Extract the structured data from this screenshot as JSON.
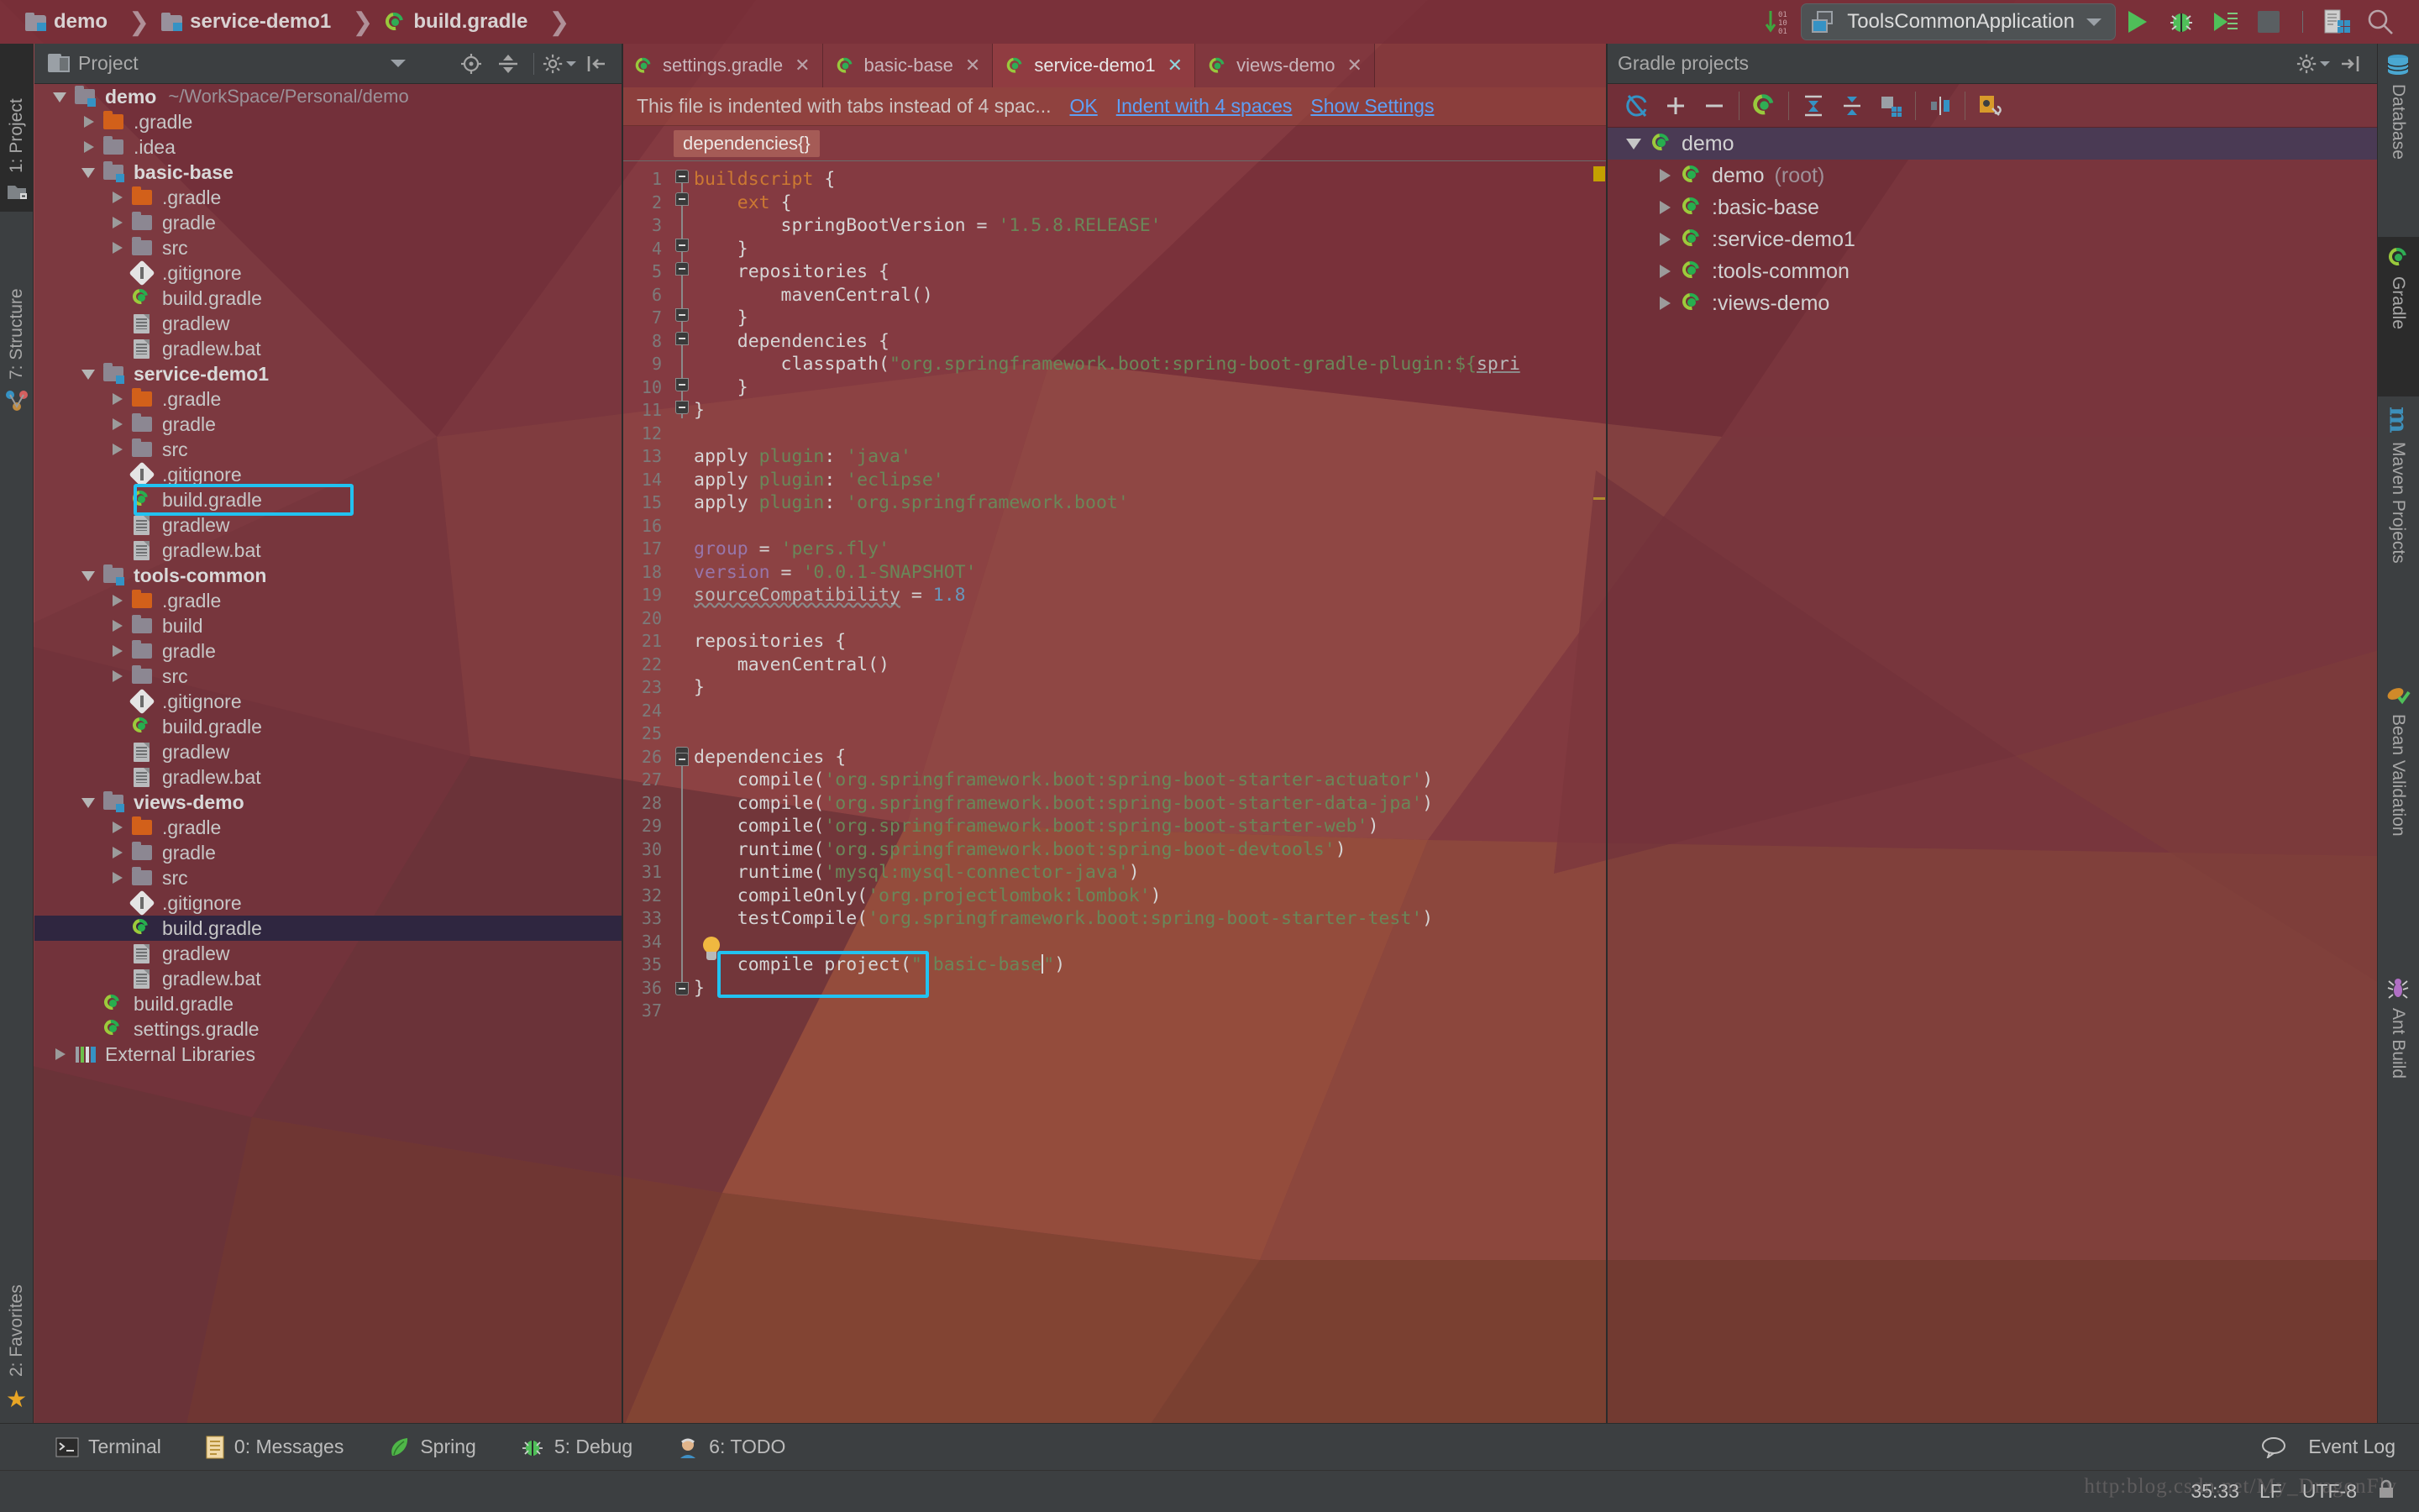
{
  "breadcrumbs": [
    {
      "label": "demo",
      "icon": "module-icon"
    },
    {
      "label": "service-demo1",
      "icon": "module-icon"
    },
    {
      "label": "build.gradle",
      "icon": "gradle-file-icon"
    }
  ],
  "toolbar": {
    "run_config": "ToolsCommonApplication",
    "icons": [
      "update-project-icon",
      "run-icon",
      "debug-icon",
      "run-coverage-icon",
      "stop-icon",
      "build-icon",
      "search-everywhere-icon"
    ]
  },
  "left_strip": {
    "tabs": [
      {
        "label": "1: Project",
        "selected": true,
        "icon": "project-icon"
      },
      {
        "label": "7: Structure",
        "selected": false,
        "icon": "structure-icon"
      },
      {
        "label": "2: Favorites",
        "selected": false,
        "icon": "star-icon"
      }
    ]
  },
  "right_strip": {
    "tabs": [
      {
        "label": "Database",
        "selected": false,
        "icon": "database-icon"
      },
      {
        "label": "Gradle",
        "selected": true,
        "icon": "gradle-icon"
      },
      {
        "label": "Maven Projects",
        "selected": false,
        "icon": "maven-icon"
      },
      {
        "label": "Bean Validation",
        "selected": false,
        "icon": "bean-validation-icon"
      },
      {
        "label": "Ant Build",
        "selected": false,
        "icon": "ant-icon"
      }
    ]
  },
  "project_panel": {
    "title": "Project",
    "toolbar_icons": [
      "locate-icon",
      "collapse-all-icon",
      "gear-icon",
      "hide-icon"
    ],
    "tree": [
      {
        "depth": 0,
        "label": "demo",
        "sub": "~/WorkSpace/Personal/demo",
        "icon": "module-icon",
        "arrow": "down",
        "bold": true
      },
      {
        "depth": 1,
        "label": ".gradle",
        "icon": "folder-orange-icon",
        "arrow": "right"
      },
      {
        "depth": 1,
        "label": ".idea",
        "icon": "folder-icon",
        "arrow": "right"
      },
      {
        "depth": 1,
        "label": "basic-base",
        "icon": "module-icon",
        "arrow": "down",
        "bold": true
      },
      {
        "depth": 2,
        "label": ".gradle",
        "icon": "folder-orange-icon",
        "arrow": "right"
      },
      {
        "depth": 2,
        "label": "gradle",
        "icon": "folder-icon",
        "arrow": "right"
      },
      {
        "depth": 2,
        "label": "src",
        "icon": "folder-icon",
        "arrow": "right"
      },
      {
        "depth": 2,
        "label": ".gitignore",
        "icon": "git-icon",
        "arrow": "none"
      },
      {
        "depth": 2,
        "label": "build.gradle",
        "icon": "gradle-file-icon",
        "arrow": "none"
      },
      {
        "depth": 2,
        "label": "gradlew",
        "icon": "file-icon",
        "arrow": "none"
      },
      {
        "depth": 2,
        "label": "gradlew.bat",
        "icon": "file-icon",
        "arrow": "none"
      },
      {
        "depth": 1,
        "label": "service-demo1",
        "icon": "module-icon",
        "arrow": "down",
        "bold": true
      },
      {
        "depth": 2,
        "label": ".gradle",
        "icon": "folder-orange-icon",
        "arrow": "right"
      },
      {
        "depth": 2,
        "label": "gradle",
        "icon": "folder-icon",
        "arrow": "right"
      },
      {
        "depth": 2,
        "label": "src",
        "icon": "folder-icon",
        "arrow": "right"
      },
      {
        "depth": 2,
        "label": ".gitignore",
        "icon": "git-icon",
        "arrow": "none"
      },
      {
        "depth": 2,
        "label": "build.gradle",
        "icon": "gradle-file-icon",
        "arrow": "none",
        "highlight": true
      },
      {
        "depth": 2,
        "label": "gradlew",
        "icon": "file-icon",
        "arrow": "none"
      },
      {
        "depth": 2,
        "label": "gradlew.bat",
        "icon": "file-icon",
        "arrow": "none"
      },
      {
        "depth": 1,
        "label": "tools-common",
        "icon": "module-icon",
        "arrow": "down",
        "bold": true
      },
      {
        "depth": 2,
        "label": ".gradle",
        "icon": "folder-orange-icon",
        "arrow": "right"
      },
      {
        "depth": 2,
        "label": "build",
        "icon": "folder-icon",
        "arrow": "right"
      },
      {
        "depth": 2,
        "label": "gradle",
        "icon": "folder-icon",
        "arrow": "right"
      },
      {
        "depth": 2,
        "label": "src",
        "icon": "folder-icon",
        "arrow": "right"
      },
      {
        "depth": 2,
        "label": ".gitignore",
        "icon": "git-icon",
        "arrow": "none"
      },
      {
        "depth": 2,
        "label": "build.gradle",
        "icon": "gradle-file-icon",
        "arrow": "none"
      },
      {
        "depth": 2,
        "label": "gradlew",
        "icon": "file-icon",
        "arrow": "none"
      },
      {
        "depth": 2,
        "label": "gradlew.bat",
        "icon": "file-icon",
        "arrow": "none"
      },
      {
        "depth": 1,
        "label": "views-demo",
        "icon": "module-icon",
        "arrow": "down",
        "bold": true
      },
      {
        "depth": 2,
        "label": ".gradle",
        "icon": "folder-orange-icon",
        "arrow": "right"
      },
      {
        "depth": 2,
        "label": "gradle",
        "icon": "folder-icon",
        "arrow": "right"
      },
      {
        "depth": 2,
        "label": "src",
        "icon": "folder-icon",
        "arrow": "right"
      },
      {
        "depth": 2,
        "label": ".gitignore",
        "icon": "git-icon",
        "arrow": "none"
      },
      {
        "depth": 2,
        "label": "build.gradle",
        "icon": "gradle-file-icon",
        "arrow": "none",
        "selected": true
      },
      {
        "depth": 2,
        "label": "gradlew",
        "icon": "file-icon",
        "arrow": "none"
      },
      {
        "depth": 2,
        "label": "gradlew.bat",
        "icon": "file-icon",
        "arrow": "none"
      },
      {
        "depth": 1,
        "label": "build.gradle",
        "icon": "gradle-file-icon",
        "arrow": "none"
      },
      {
        "depth": 1,
        "label": "settings.gradle",
        "icon": "gradle-file-icon",
        "arrow": "none"
      },
      {
        "depth": 0,
        "label": "External Libraries",
        "icon": "library-icon",
        "arrow": "right"
      }
    ]
  },
  "editor": {
    "tabs": [
      {
        "label": "settings.gradle",
        "active": false
      },
      {
        "label": "basic-base",
        "active": false
      },
      {
        "label": "service-demo1",
        "active": true
      },
      {
        "label": "views-demo",
        "active": false
      }
    ],
    "notice": {
      "text": "This file is indented with tabs instead of 4 spac...",
      "actions": [
        "OK",
        "Indent with 4 spaces",
        "Show Settings"
      ]
    },
    "breadcrumb_chip": "dependencies{}",
    "lines": [
      {
        "n": 1,
        "html": "<span class=\"kw\">buildscript</span> {"
      },
      {
        "n": 2,
        "html": "    <span class=\"kw\">ext</span> {"
      },
      {
        "n": 3,
        "html": "        springBootVersion = <span class=\"str\">'1.5.8.RELEASE'</span>"
      },
      {
        "n": 4,
        "html": "    }"
      },
      {
        "n": 5,
        "html": "    repositories {"
      },
      {
        "n": 6,
        "html": "        mavenCentral()"
      },
      {
        "n": 7,
        "html": "    }"
      },
      {
        "n": 8,
        "html": "    dependencies {"
      },
      {
        "n": 9,
        "html": "        classpath(<span class=\"str\">\"org.springframework.boot:spring-boot-gradle-plugin:${</span><span class=\"ident-u\">spri</span>"
      },
      {
        "n": 10,
        "html": "    }"
      },
      {
        "n": 11,
        "html": "}"
      },
      {
        "n": 12,
        "html": ""
      },
      {
        "n": 13,
        "html": "apply <span class=\"str\">plugin</span>: <span class=\"str\">'java'</span>"
      },
      {
        "n": 14,
        "html": "apply <span class=\"str\">plugin</span>: <span class=\"str\">'eclipse'</span>"
      },
      {
        "n": 15,
        "html": "apply <span class=\"str\">plugin</span>: <span class=\"str\">'org.springframework.boot'</span>"
      },
      {
        "n": 16,
        "html": ""
      },
      {
        "n": 17,
        "html": "<span class=\"pp\">group</span> = <span class=\"str\">'pers.fly'</span>"
      },
      {
        "n": 18,
        "html": "<span class=\"pp\">version</span> = <span class=\"str\">'0.0.1-SNAPSHOT'</span>"
      },
      {
        "n": 19,
        "html": "<span class=\"ident-u squig\">sourceCompatibility</span> = <span class=\"num\">1.8</span>"
      },
      {
        "n": 20,
        "html": ""
      },
      {
        "n": 21,
        "html": "repositories {"
      },
      {
        "n": 22,
        "html": "    mavenCentral()"
      },
      {
        "n": 23,
        "html": "}"
      },
      {
        "n": 24,
        "html": ""
      },
      {
        "n": 25,
        "html": ""
      },
      {
        "n": 26,
        "html": "dependencies {"
      },
      {
        "n": 27,
        "html": "    compile(<span class=\"str\">'org.springframework.boot:spring-boot-starter-actuator'</span>)"
      },
      {
        "n": 28,
        "html": "    compile(<span class=\"str\">'org.springframework.boot:spring-boot-starter-data-jpa'</span>)"
      },
      {
        "n": 29,
        "html": "    compile(<span class=\"str\">'org.springframework.boot:spring-boot-starter-web'</span>)"
      },
      {
        "n": 30,
        "html": "    runtime(<span class=\"str\">'org.springframework.boot:spring-boot-devtools'</span>)"
      },
      {
        "n": 31,
        "html": "    runtime(<span class=\"str\">'mysql:mysql-connector-java'</span>)"
      },
      {
        "n": 32,
        "html": "    compileOnly(<span class=\"str\">'org.projectlombok:lombok'</span>)"
      },
      {
        "n": 33,
        "html": "    testCompile(<span class=\"str\">'org.springframework.boot:spring-boot-starter-test'</span>)"
      },
      {
        "n": 34,
        "html": ""
      },
      {
        "n": 35,
        "html": "    compile project(<span class=\"str\">\":basic-base</span><span class=\"caret\"></span><span class=\"str\">\"</span>)"
      },
      {
        "n": 36,
        "html": "}"
      },
      {
        "n": 37,
        "html": ""
      }
    ],
    "highlight_line_text": "compile project(\":basic-base\")"
  },
  "gradle_panel": {
    "title": "Gradle projects",
    "toolbar_icons": [
      "refresh-icon",
      "add-icon",
      "remove-icon",
      "gradle-icon",
      "expand-all-icon",
      "collapse-all-icon",
      "modules-icon",
      "toggle-offline-icon",
      "gradle-settings-icon"
    ],
    "header_icons": [
      "gear-icon",
      "hide-icon"
    ],
    "tree": [
      {
        "depth": 0,
        "label": "demo",
        "arrow": "down",
        "selected": true
      },
      {
        "depth": 1,
        "label": "demo",
        "suffix": "(root)",
        "arrow": "right"
      },
      {
        "depth": 1,
        "label": ":basic-base",
        "arrow": "right"
      },
      {
        "depth": 1,
        "label": ":service-demo1",
        "arrow": "right"
      },
      {
        "depth": 1,
        "label": ":tools-common",
        "arrow": "right"
      },
      {
        "depth": 1,
        "label": ":views-demo",
        "arrow": "right"
      }
    ]
  },
  "bottom_bar": {
    "items": [
      {
        "label": "Terminal",
        "icon": "terminal-icon",
        "mnemonic": ""
      },
      {
        "label": "0: Messages",
        "icon": "messages-icon"
      },
      {
        "label": "Spring",
        "icon": "spring-icon"
      },
      {
        "label": "5: Debug",
        "icon": "debug-icon"
      },
      {
        "label": "6: TODO",
        "icon": "todo-icon"
      }
    ],
    "event_log": "Event Log",
    "event_log_icon": "balloon-icon"
  },
  "status_bar": {
    "position": "35:33",
    "line_separator": "LF",
    "encoding": "UTF-8",
    "lock_icon": "lock-icon",
    "watermark": "http:blog.csdn.net/My_DragonFly"
  },
  "colors": {
    "accent_cyan": "#22c2f0",
    "link_blue": "#5f9ff4",
    "gradle_green": "#27ae4e",
    "folder_orange": "#d2601a",
    "selection_purple": "#2f2640",
    "chrome_gray": "#3c3f41"
  }
}
